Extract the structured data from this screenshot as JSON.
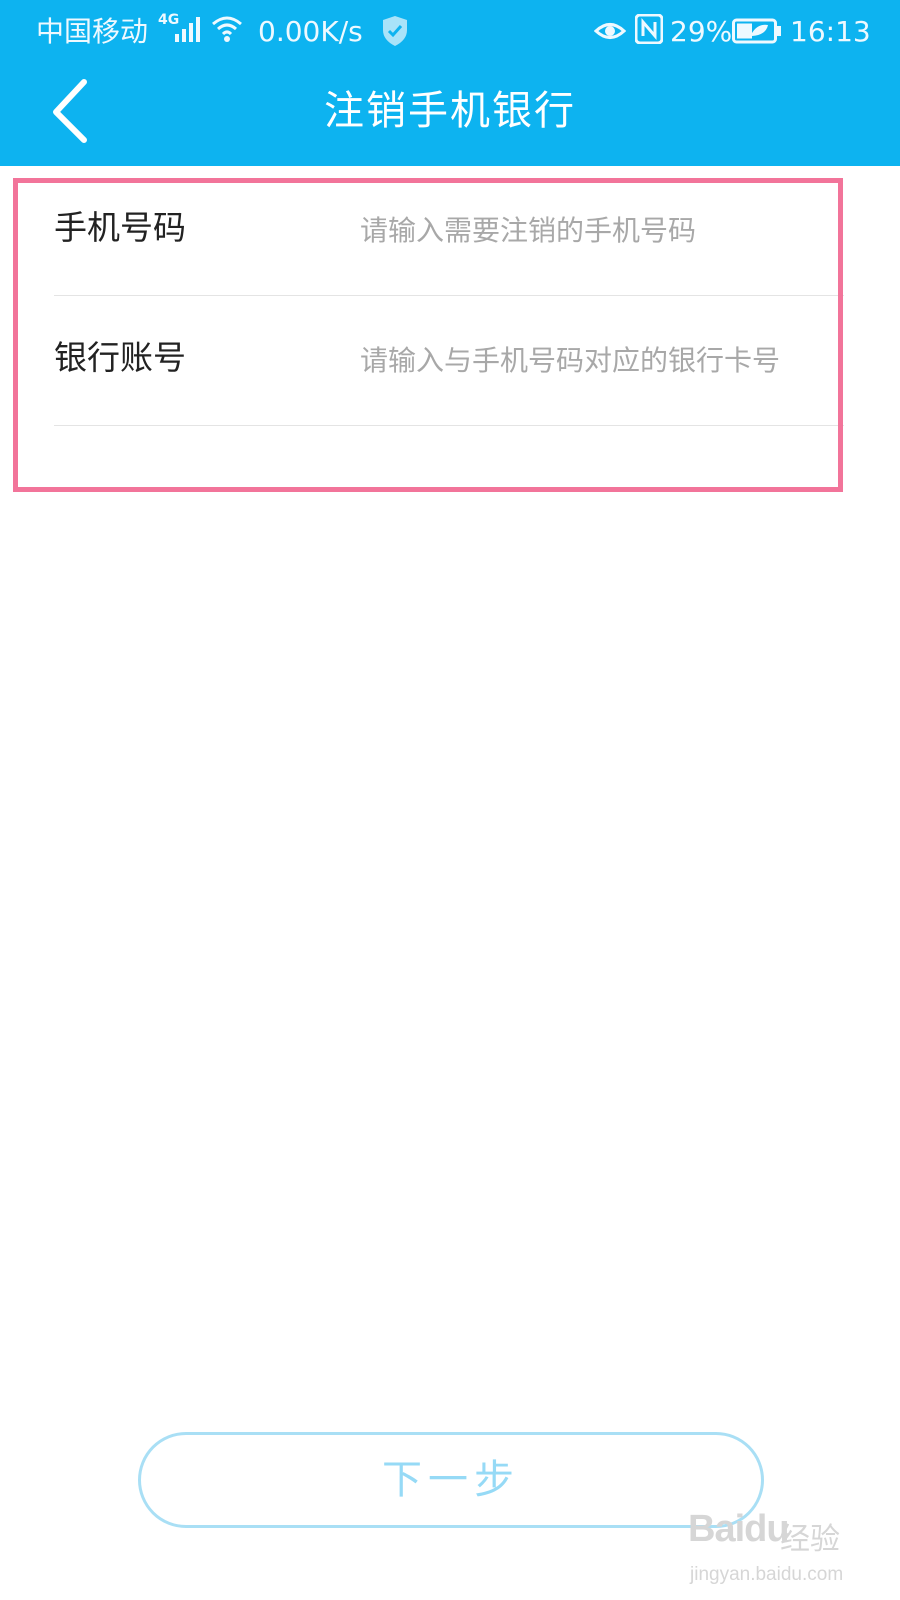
{
  "status_bar": {
    "carrier": "中国移动",
    "network": "4G",
    "speed": "0.00K/s",
    "battery": "29%",
    "time": "16:13",
    "icons": [
      "signal-icon",
      "wifi-icon",
      "shield-icon",
      "eye-icon",
      "nfc-icon",
      "battery-icon"
    ]
  },
  "header": {
    "title": "注销手机银行",
    "back_icon": "chevron-left-icon"
  },
  "form": {
    "fields": [
      {
        "label": "手机号码",
        "placeholder": "请输入需要注销的手机号码",
        "value": ""
      },
      {
        "label": "银行账号",
        "placeholder": "请输入与手机号码对应的银行卡号",
        "value": ""
      }
    ]
  },
  "next_button": {
    "label": "下一步"
  },
  "watermark": {
    "logo": "Baidu",
    "sub": "经验",
    "url": "jingyan.baidu.com"
  },
  "colors": {
    "header_bg": "#0db3f0",
    "highlight": "#f2749a",
    "button_border": "#a9dff5",
    "button_text": "#96daf6"
  }
}
